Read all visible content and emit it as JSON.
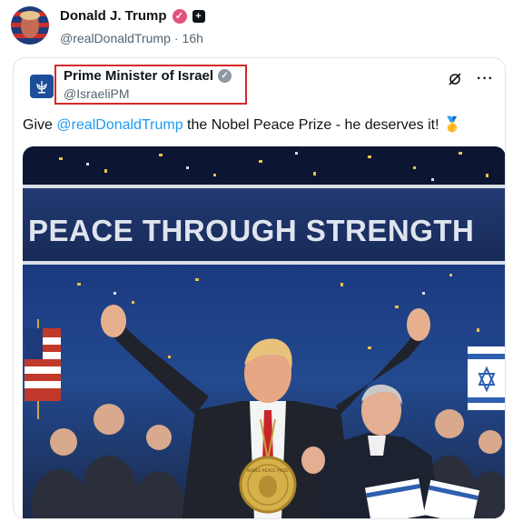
{
  "post": {
    "author_name": "Donald J. Trump",
    "handle": "@realDonaldTrump",
    "separator": "·",
    "time": "16h"
  },
  "quote": {
    "author_name": "Prime Minister of Israel",
    "handle": "@IsraeliPM",
    "text_before": "Give ",
    "mention": "@realDonaldTrump",
    "text_after": " the Nobel Peace Prize - he deserves it! ",
    "emoji": "🥇"
  },
  "media": {
    "banner_text": "PEACE THROUGH STRENGTH",
    "medal_text": "NOBEL PEACE PRIZE"
  },
  "icons": {
    "verified": "verified-badge-icon",
    "affiliation": "affiliation-badge-icon",
    "grok": "grok-icon",
    "more": "more-icon"
  },
  "colors": {
    "mention": "#1d9bf0",
    "verified_pink": "#e2517c",
    "highlight": "#d62828"
  }
}
